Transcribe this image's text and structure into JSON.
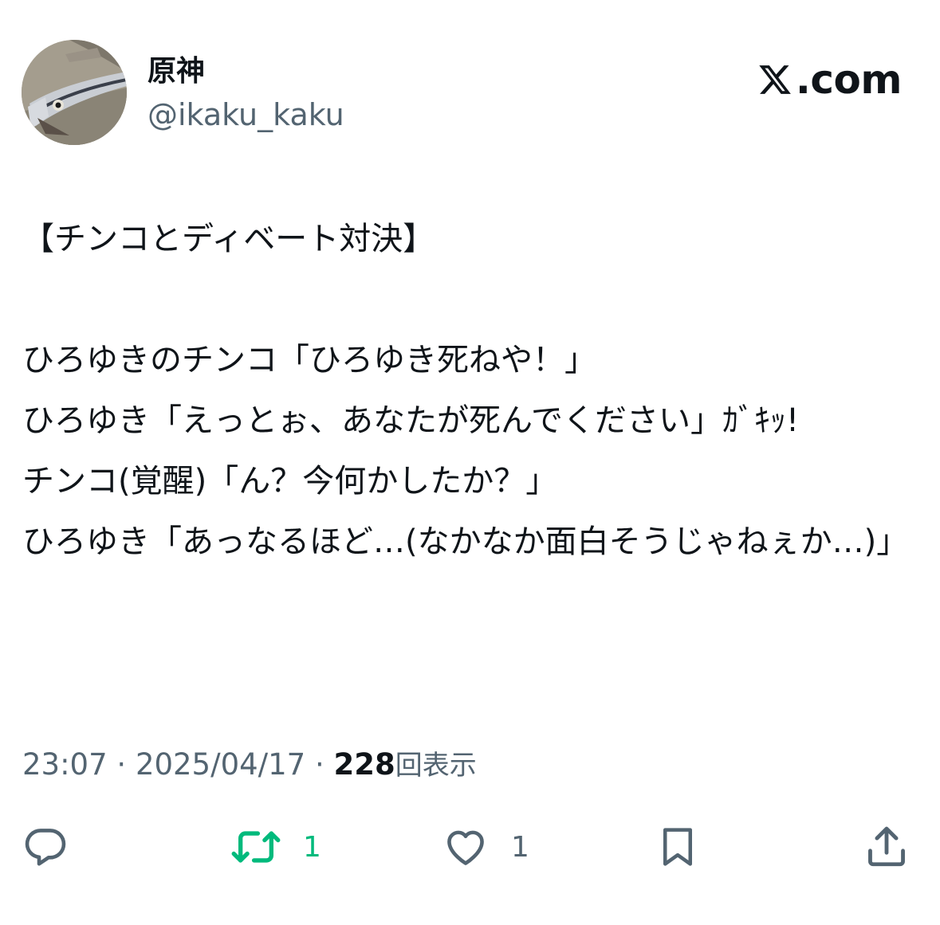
{
  "header": {
    "display_name": "原神",
    "handle": "@ikaku_kaku",
    "brand_logo": "x-logo",
    "brand_domain": ".com"
  },
  "post": {
    "text": "【チンコとディベート対決】\n\nひろゆきのチンコ「ひろゆき死ねや！」\nひろゆき「えっとぉ、あなたが死んでください」ｶﾞｷｯ!\nチンコ(覚醒)「ん？今何かしたか？」\nひろゆき「あっなるほど…(なかなか面白そうじゃねぇか…)」"
  },
  "meta": {
    "time": "23:07",
    "separator": "·",
    "date": "2025/04/17",
    "views_count": "228",
    "views_label": "回表示"
  },
  "actions": {
    "reply_icon": "speech-bubble-icon",
    "repost_icon": "repost-arrows-icon",
    "repost_count": "1",
    "like_icon": "heart-icon",
    "like_count": "1",
    "bookmark_icon": "bookmark-icon",
    "share_icon": "share-upload-icon"
  },
  "colors": {
    "text": "#0f1419",
    "secondary": "#536471",
    "repost_green": "#00ba7c"
  }
}
